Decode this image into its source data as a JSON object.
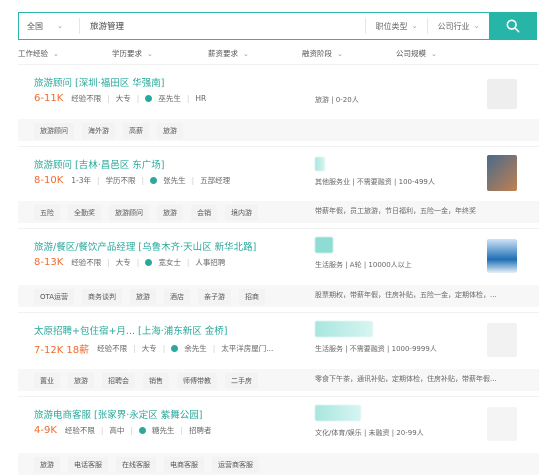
{
  "search": {
    "city": "全国",
    "keyword": "旅游管理",
    "job_type": "职位类型",
    "industry": "公司行业"
  },
  "filters": [
    "工作经验",
    "学历要求",
    "薪资要求",
    "融资阶段",
    "公司规模"
  ],
  "jobs": [
    {
      "title": "旅游顾问  [深圳·福田区 华强南]",
      "salary": "6-11K",
      "exp": "经验不限",
      "edu": "大专",
      "contact": "巫先生",
      "role": "HR",
      "company_info": "旅游  |  0-20人",
      "tags": [
        "旅游顾问",
        "海外游",
        "高薪",
        "旅游"
      ],
      "welfare": ""
    },
    {
      "title": "旅游顾问  [吉林·昌邑区 东广场]",
      "salary": "8-10K",
      "exp": "1-3年",
      "edu": "学历不限",
      "contact": "张先生",
      "role": "五部经理",
      "company_info": "其他服务业  |  不需要融资  |  100-499人",
      "tags": [
        "五险",
        "全勤奖",
        "旅游顾问",
        "旅游",
        "会销",
        "境内游"
      ],
      "welfare": "带薪年假，员工旅游，节日福利，五险一金，年终奖"
    },
    {
      "title": "旅游/餐区/餐饮产品经理  [乌鲁木齐·天山区 新华北路]",
      "salary": "8-13K",
      "exp": "经验不限",
      "edu": "大专",
      "contact": "宽女士",
      "role": "人事招聘",
      "company_info": "生活服务  |  A轮  |  10000人以上",
      "tags": [
        "OTA运营",
        "商务谈判",
        "旅游",
        "酒店",
        "亲子游",
        "招商"
      ],
      "welfare": "股票期权，带薪年假，住房补贴，五险一金，定期体检，..."
    },
    {
      "title": "太原招聘+包住宿+月...  [上海·浦东新区 金桥]",
      "salary": "7-12K 18薪",
      "exp": "经验不限",
      "edu": "大专",
      "contact": "余先生",
      "role": "太平洋房屋门...",
      "company_info": "生活服务  |  不需要融资  |  1000-9999人",
      "tags": [
        "置业",
        "旅游",
        "招聘会",
        "销售",
        "师傅带教",
        "二手房"
      ],
      "welfare": "零食下午茶，通讯补贴，定期体检，住房补贴，带薪年假..."
    },
    {
      "title": "旅游电商客服  [张家界·永定区 紫舞公园]",
      "salary": "4-9K",
      "exp": "经验不限",
      "edu": "高中",
      "contact": "糖先生",
      "role": "招聘者",
      "company_info": "文化/体育/娱乐  |  未融资  |  20-99人",
      "tags": [
        "旅游",
        "电话客服",
        "在线客服",
        "电商客服",
        "运营商客服"
      ],
      "welfare": ""
    }
  ]
}
